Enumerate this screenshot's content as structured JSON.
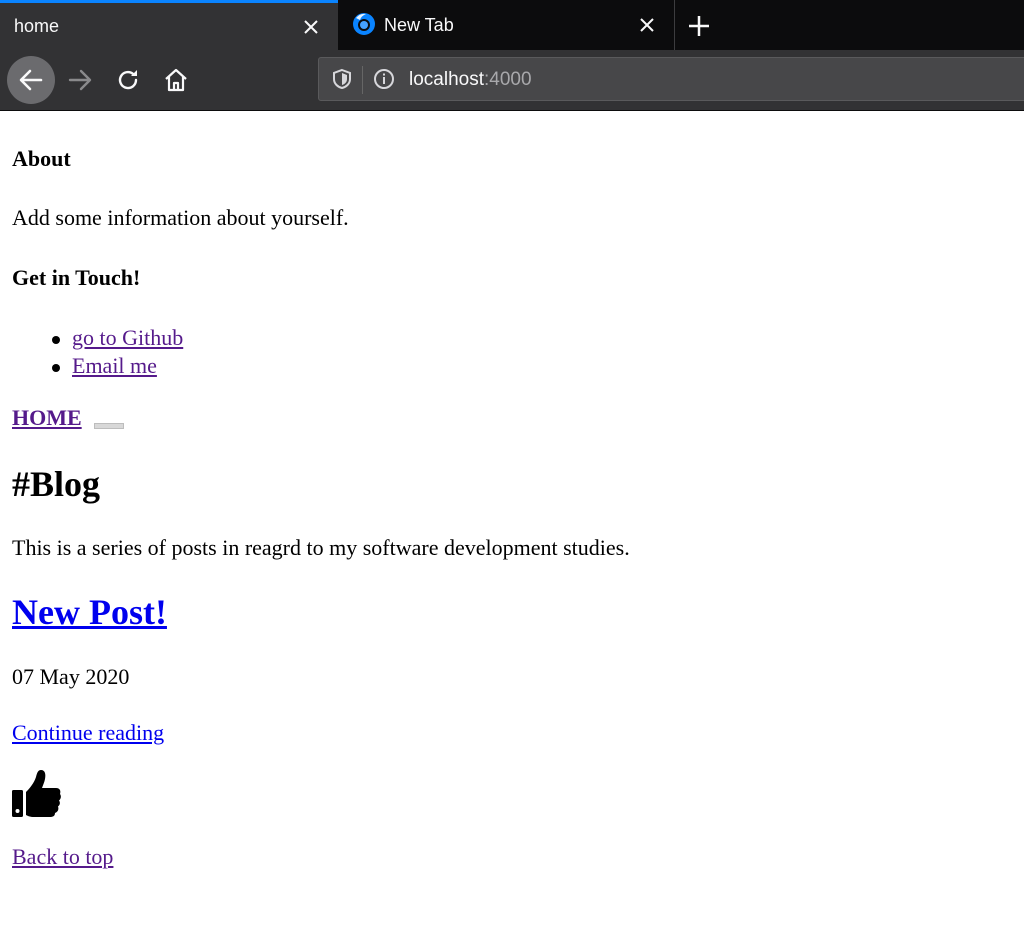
{
  "browser": {
    "tabs": [
      {
        "title": "home",
        "active": true
      },
      {
        "title": "New Tab",
        "active": false
      }
    ],
    "url_host": "localhost",
    "url_port": ":4000",
    "accent_color": "#0a84ff"
  },
  "page": {
    "about_heading": "About",
    "about_text": "Add some information about yourself.",
    "contact_heading": "Get in Touch!",
    "contact_links": [
      {
        "label": "go to Github"
      },
      {
        "label": "Email me"
      }
    ],
    "home_link": "HOME",
    "blog_heading": "#Blog",
    "blog_intro": "This is a series of posts in reagrd to my software development studies.",
    "post": {
      "title": "New Post!",
      "date": "07 May 2020",
      "continue_label": "Continue reading"
    },
    "like_icon": "thumbs-up-icon",
    "back_to_top": "Back to top"
  }
}
